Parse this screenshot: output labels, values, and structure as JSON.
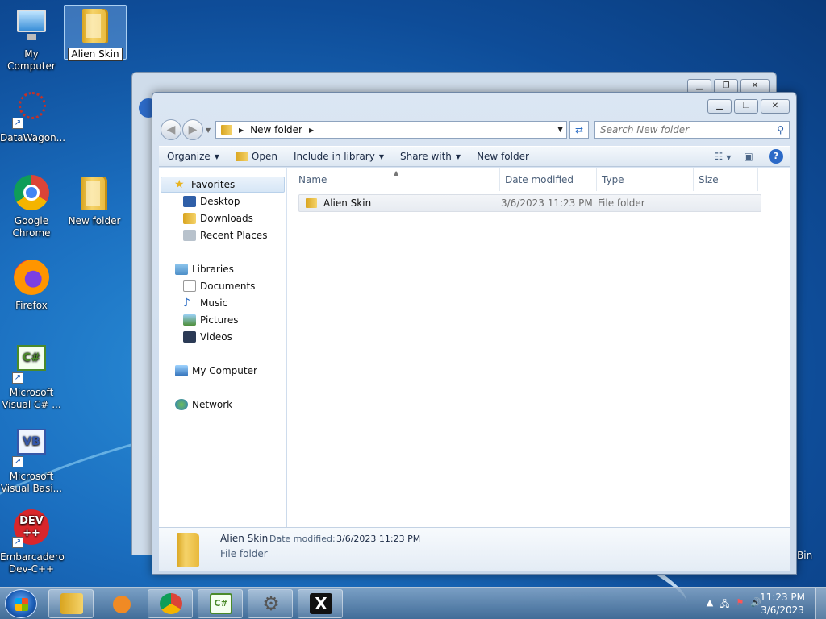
{
  "desktop": {
    "icons": [
      {
        "label": "My Computer"
      },
      {
        "label": "Alien Skin"
      },
      {
        "label": "DataWagon..."
      },
      {
        "label": "Google Chrome"
      },
      {
        "label": "New folder"
      },
      {
        "label": "Firefox"
      },
      {
        "label": "Microsoft Visual C# ..."
      },
      {
        "label": "Microsoft Visual Basi..."
      },
      {
        "label": "Embarcadero Dev-C++"
      }
    ],
    "bin_label": "Bin"
  },
  "explorer": {
    "caption_buttons": {
      "minimize": "▁",
      "maximize": "❐",
      "close": "✕"
    },
    "address": {
      "path": "New folder",
      "search_placeholder": "Search New folder"
    },
    "toolbar": {
      "organize": "Organize",
      "open": "Open",
      "include_in_library": "Include in library",
      "share_with": "Share with",
      "new_folder": "New folder"
    },
    "nav": {
      "favorites": "Favorites",
      "desktop": "Desktop",
      "downloads": "Downloads",
      "recent_places": "Recent Places",
      "libraries": "Libraries",
      "documents": "Documents",
      "music": "Music",
      "pictures": "Pictures",
      "videos": "Videos",
      "my_computer": "My Computer",
      "network": "Network"
    },
    "columns": {
      "name": "Name",
      "date_modified": "Date modified",
      "type": "Type",
      "size": "Size"
    },
    "files": [
      {
        "name": "Alien Skin",
        "date_modified": "3/6/2023 11:23 PM",
        "type": "File folder",
        "size": ""
      }
    ],
    "details": {
      "name": "Alien Skin",
      "date_label": "Date modified:",
      "date_value": "3/6/2023 11:23 PM",
      "type": "File folder"
    }
  },
  "taskbar": {
    "clock_time": "11:23 PM",
    "clock_date": "3/6/2023",
    "apps": [
      "file-explorer",
      "media-player",
      "google-chrome",
      "visual-csharp",
      "settings",
      "x-app"
    ]
  }
}
